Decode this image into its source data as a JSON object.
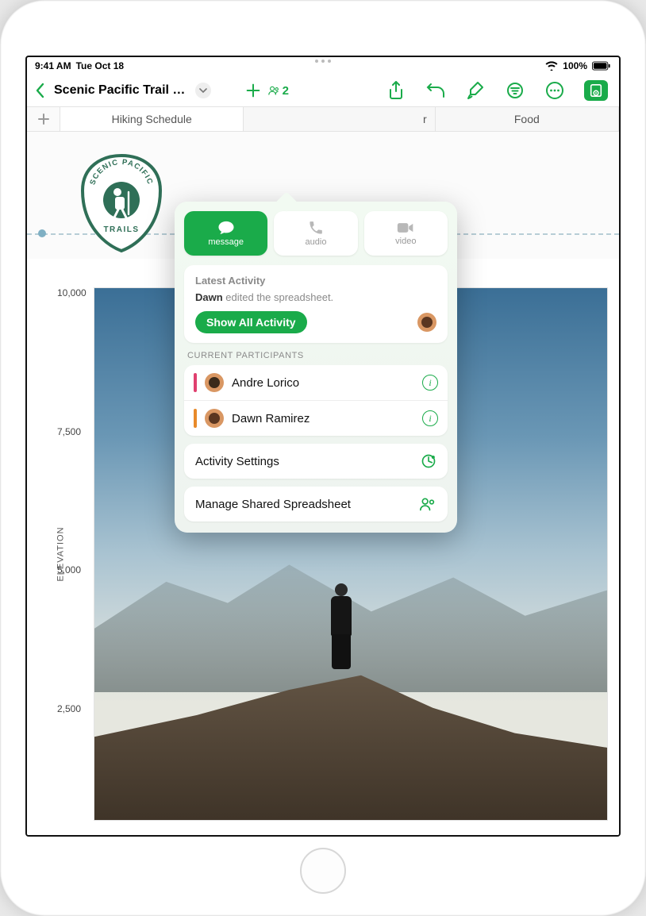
{
  "status": {
    "time": "9:41 AM",
    "date": "Tue Oct 18",
    "battery_pct": "100%"
  },
  "toolbar": {
    "doc_title": "Scenic Pacific Trail Se...",
    "collab_count": "2"
  },
  "tabs": {
    "tab1": "Hiking Schedule",
    "tab2": "",
    "tab2_suffix": "r",
    "tab3": "Food"
  },
  "logo": {
    "top_arc": "SCENIC PACIFIC",
    "bottom": "TRAILS"
  },
  "popover": {
    "comm": {
      "message": "message",
      "audio": "audio",
      "video": "video"
    },
    "latest": {
      "title": "Latest Activity",
      "actor": "Dawn",
      "rest": " edited the spreadsheet.",
      "show_all": "Show All Activity"
    },
    "participants_label": "CURRENT PARTICIPANTS",
    "participants": [
      {
        "name": "Andre Lorico",
        "color": "#e0406f"
      },
      {
        "name": "Dawn Ramirez",
        "color": "#e88a2a"
      }
    ],
    "activity_settings": "Activity Settings",
    "manage_shared": "Manage Shared Spreadsheet"
  },
  "chart_data": {
    "type": "other",
    "ylabel": "ELEVATION",
    "yticks": [
      "10,000",
      "7,500",
      "5,000",
      "2,500"
    ],
    "ylim": [
      0,
      10000
    ]
  }
}
